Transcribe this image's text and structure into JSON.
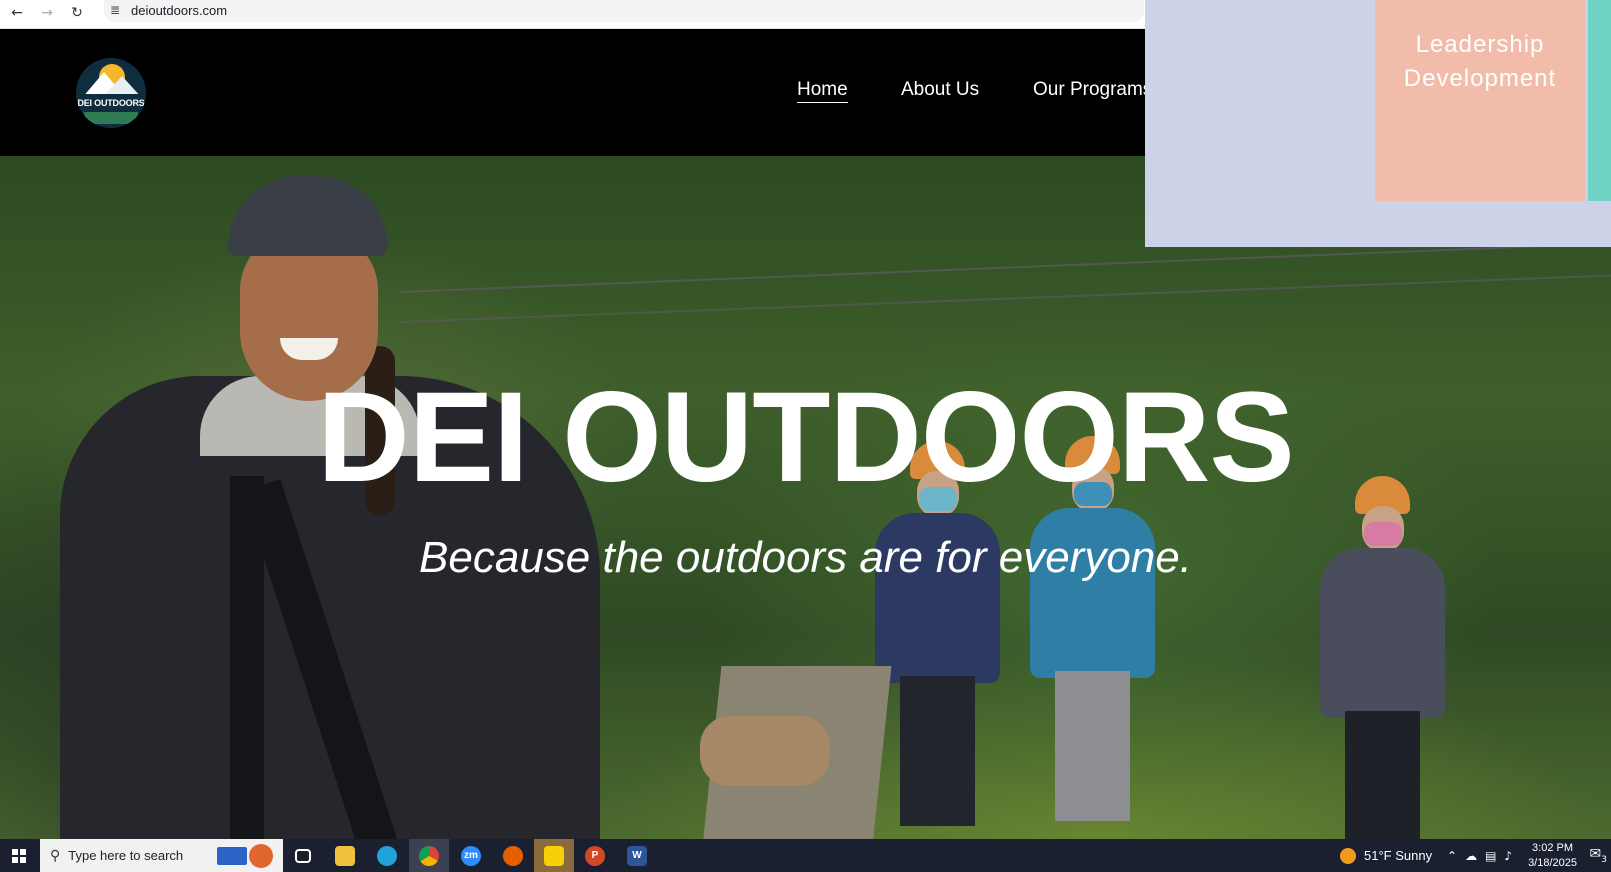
{
  "browser": {
    "url": "deioutdoors.com",
    "back_icon": "←",
    "forward_icon": "→",
    "reload_icon": "↻",
    "site_info_icon": "≣"
  },
  "site": {
    "logo_text": "DEI OUTDOORS",
    "nav": [
      {
        "label": "Home",
        "active": true
      },
      {
        "label": "About Us",
        "active": false
      },
      {
        "label": "Our Programs",
        "active": false
      }
    ],
    "hero_title": "DEI OUTDOORS",
    "hero_tagline": "Because the outdoors are for everyone."
  },
  "dropdown": {
    "card_label": "Leadership\nDevelopment",
    "colors": {
      "panel": "#ccd3e8",
      "card": "#f2bcaa",
      "edge": "#6fd4c3"
    }
  },
  "taskbar": {
    "search_placeholder": "Type here to search",
    "apps": [
      "task-view",
      "file-explorer",
      "edge",
      "chrome",
      "zoom",
      "firefox",
      "sticky-notes",
      "powerpoint",
      "word"
    ],
    "zoom_label": "zm",
    "powerpoint_label": "P",
    "word_label": "W",
    "weather": "51°F  Sunny",
    "time": "3:02 PM",
    "date": "3/18/2025",
    "notification_count": "3"
  }
}
